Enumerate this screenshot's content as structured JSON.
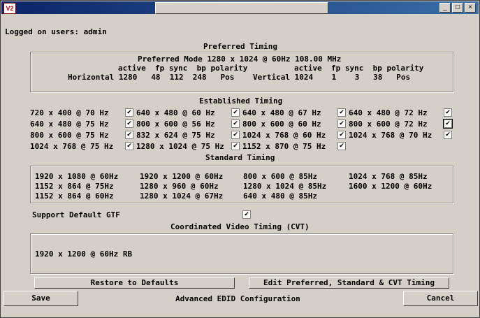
{
  "titlebar": {
    "app_icon": "V2",
    "minimize": "_",
    "maximize": "□",
    "close": "×"
  },
  "logged_on": "Logged on users: admin",
  "preferred": {
    "header": "Preferred Timing",
    "mode": "Preferred Mode 1280 x 1024 @ 60Hz 108.00 MHz",
    "columns": "active  fp sync  bp polarity",
    "horizontal": "Horizontal 1280   48  112  248   Pos",
    "vertical": "Vertical 1024    1    3   38   Pos"
  },
  "established": {
    "header": "Established Timing",
    "items": [
      {
        "label": "720 x 400 @ 70 Hz",
        "checked": true
      },
      {
        "label": "640 x 480 @ 60 Hz",
        "checked": true
      },
      {
        "label": "640 x 480 @ 67 Hz",
        "checked": true
      },
      {
        "label": "640 x 480 @ 72 Hz",
        "checked": true
      },
      {
        "label": "640 x 480 @ 75 Hz",
        "checked": true
      },
      {
        "label": "800 x 600 @ 56 Hz",
        "checked": true
      },
      {
        "label": "800 x 600 @ 60 Hz",
        "checked": true
      },
      {
        "label": "800 x 600 @ 72 Hz",
        "checked": true
      },
      {
        "label": "800 x 600 @ 75 Hz",
        "checked": true
      },
      {
        "label": "832 x 624 @ 75 Hz",
        "checked": true
      },
      {
        "label": "1024 x 768 @ 60 Hz",
        "checked": true
      },
      {
        "label": "1024 x 768 @ 70 Hz",
        "checked": true
      },
      {
        "label": "1024 x 768 @ 75 Hz",
        "checked": true
      },
      {
        "label": "1280 x 1024 @ 75 Hz",
        "checked": true
      },
      {
        "label": "1152 x 870 @ 75 Hz",
        "checked": true
      }
    ]
  },
  "standard": {
    "header": "Standard Timing",
    "items": [
      "1920 x 1080 @ 60Hz",
      "1920 x 1200 @ 60Hz",
      "800 x 600 @ 85Hz",
      "1024 x 768 @ 85Hz",
      "1152 x 864 @ 75Hz",
      "1280 x 960 @ 60Hz",
      "1280 x 1024 @ 85Hz",
      "1600 x 1200 @ 60Hz",
      "1152 x 864 @ 60Hz",
      "1280 x 1024 @ 67Hz",
      "640 x 480 @ 85Hz"
    ]
  },
  "gtf": {
    "label": "Support Default GTF",
    "checked": true
  },
  "cvt": {
    "header": "Coordinated Video Timing (CVT)",
    "items": [
      "1920 x 1200 @ 60Hz RB"
    ]
  },
  "buttons": {
    "restore": "Restore to Defaults",
    "edit": "Edit Preferred, Standard & CVT Timing",
    "save": "Save",
    "cancel": "Cancel"
  },
  "footer_title": "Advanced EDID Configuration"
}
